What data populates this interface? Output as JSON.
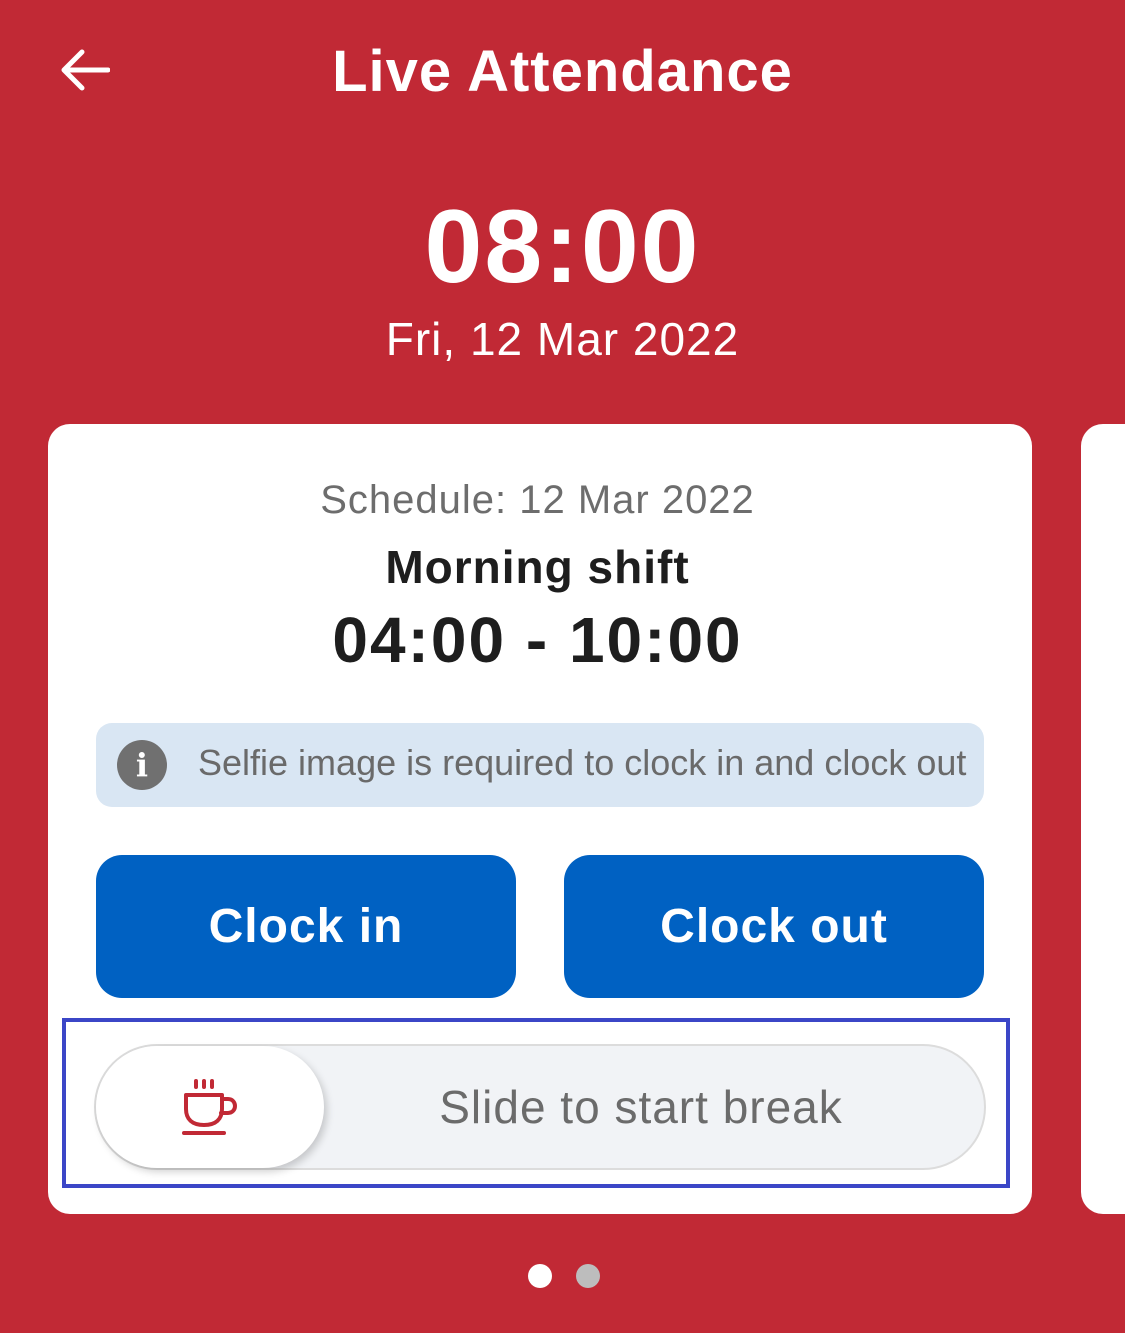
{
  "header": {
    "title": "Live Attendance",
    "back_icon": "arrow-left-icon"
  },
  "clock": {
    "time": "08:00",
    "date": "Fri, 12 Mar 2022"
  },
  "card": {
    "schedule": "Schedule: 12 Mar 2022",
    "shift_name": "Morning shift",
    "shift_time": "04:00 - 10:00",
    "info": {
      "icon": "info-icon",
      "text": "Selfie image is required to clock in and clock out"
    },
    "buttons": {
      "clock_in": "Clock in",
      "clock_out": "Clock out"
    },
    "break_slider": {
      "icon": "coffee-cup-icon",
      "label": "Slide to start break"
    }
  },
  "pager": {
    "total": 2,
    "active": 1
  },
  "colors": {
    "background": "#C12935",
    "primary": "#0061C2",
    "info_bg": "#D9E6F3",
    "accent_icon": "#C12935"
  }
}
